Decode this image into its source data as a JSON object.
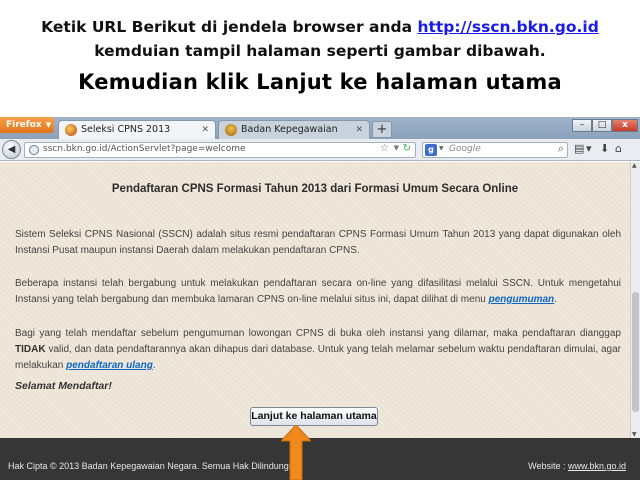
{
  "banner": {
    "line1_text": "Ketik URL Berikut di jendela browser anda ",
    "line1_link": "http://sscn.bkn.go.id",
    "line2": "kemduian tampil halaman seperti gambar dibawah.",
    "line3": "Kemudian klik Lanjut ke halaman utama"
  },
  "browser": {
    "menu_button": "Firefox",
    "tabs": [
      {
        "label": "Seleksi CPNS 2013",
        "active": true
      },
      {
        "label": "Badan Kepegawaian Negara",
        "active": false
      }
    ],
    "new_tab": "+",
    "url": "sscn.bkn.go.id/ActionServlet?page=welcome",
    "search_placeholder": "Google",
    "window_controls": {
      "minimize": "–",
      "maximize": "□",
      "close": "x"
    }
  },
  "page": {
    "title": "Pendaftaran CPNS Formasi Tahun 2013 dari Formasi Umum Secara Online",
    "para1": "Sistem Seleksi CPNS Nasional (SSCN) adalah situs resmi pendaftaran CPNS Formasi Umum Tahun 2013 yang dapat digunakan oleh Instansi Pusat maupun instansi Daerah dalam melakukan pendaftaran CPNS.",
    "para2_text": "Beberapa instansi telah bergabung untuk melakukan pendaftaran secara on-line yang difasilitasi melalui SSCN. Untuk mengetahui Instansi yang telah bergabung dan membuka lamaran CPNS on-line melalui situs ini, dapat dilihat di menu ",
    "para2_link": "pengumuman",
    "para2_end": ".",
    "para3_a": "Bagi yang telah mendaftar sebelum pengumuman lowongan CPNS di buka oleh instansi yang dilamar, maka pendaftaran dianggap ",
    "para3_bold": "TIDAK",
    "para3_b": " valid, dan data pendaftarannya akan dihapus dari database. Untuk yang telah melamar sebelum waktu pendaftaran dimulai, agar melakukan ",
    "para3_link": "pendaftaran ulang",
    "para3_end": ".",
    "greeting": "Selamat Mendaftar!",
    "main_button": "Lanjut ke halaman utama"
  },
  "footer": {
    "copyright": "Hak Cipta © 2013 Badan Kepegawaian Negara. Semua Hak Dilindungi.",
    "website_label": "Website : ",
    "website_link": "www.bkn.go.id"
  },
  "colors": {
    "page_bg": "#efe7d9",
    "link": "#0a65c9",
    "footer_bg": "#363636",
    "arrow": "#f08a1c"
  }
}
